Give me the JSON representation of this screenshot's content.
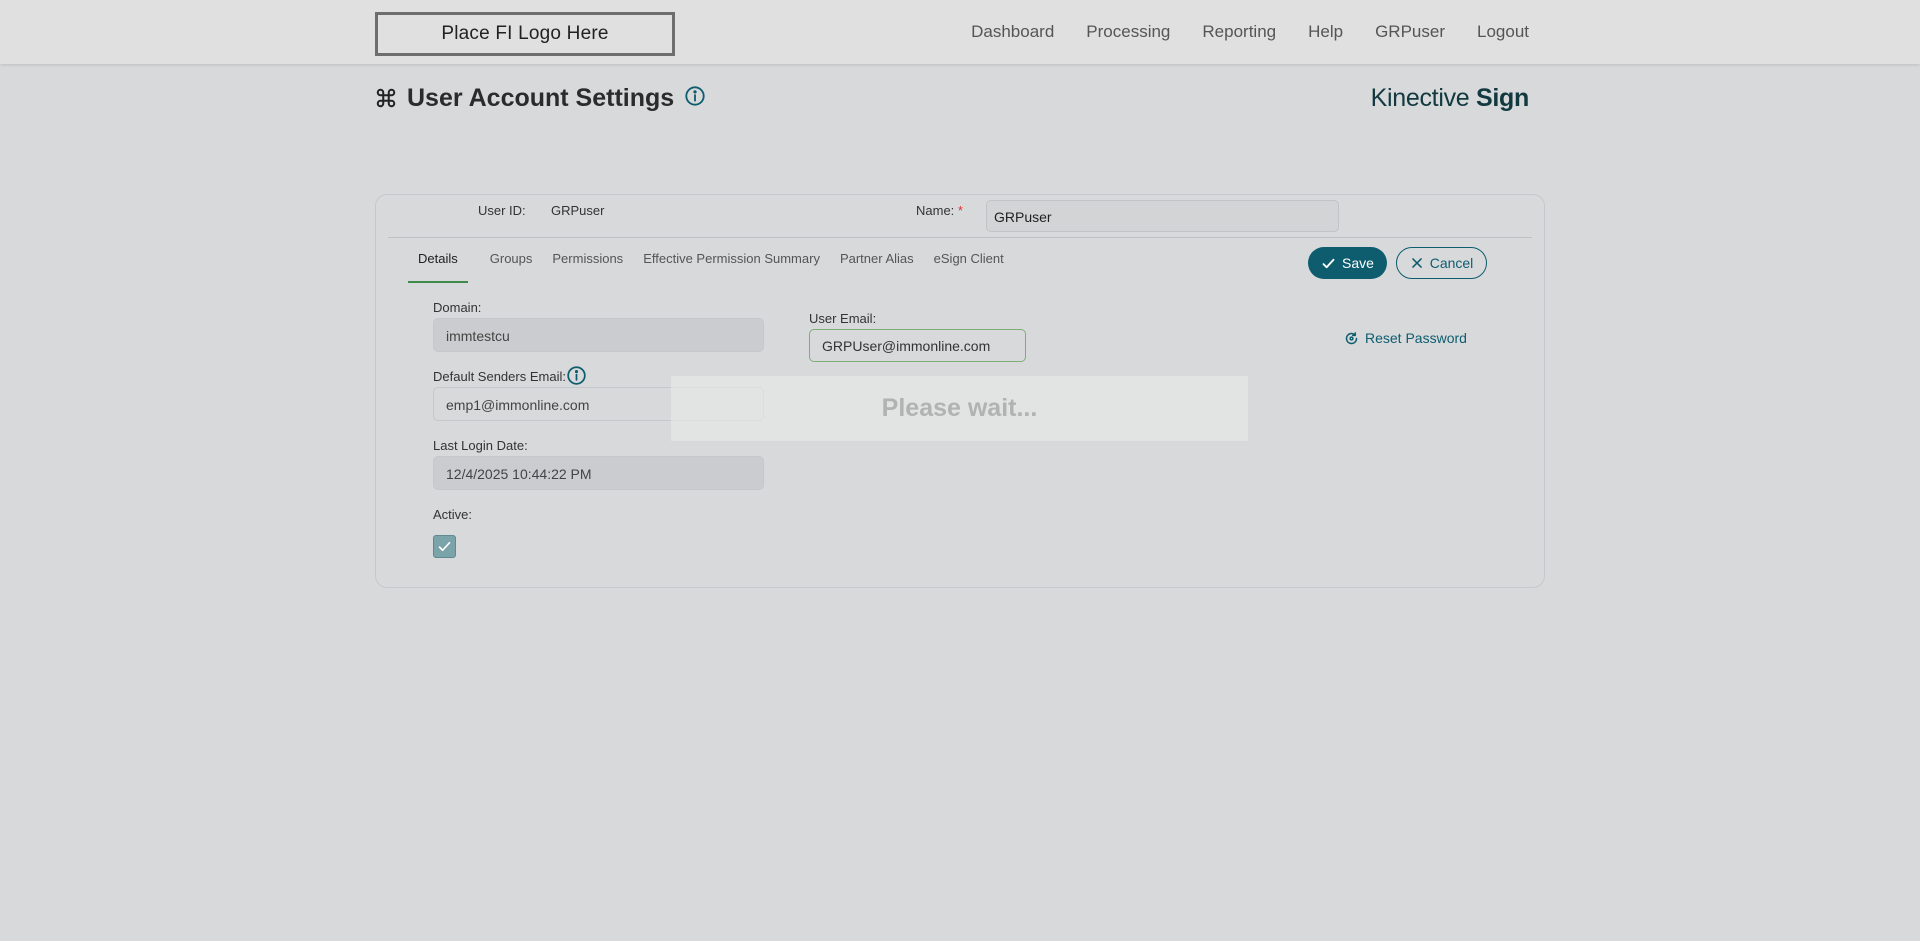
{
  "header": {
    "logo_text": "Place FI Logo Here",
    "nav": [
      "Dashboard",
      "Processing",
      "Reporting",
      "Help",
      "GRPuser",
      "Logout"
    ]
  },
  "page": {
    "title": "User Account Settings",
    "title_icon": "command-icon",
    "brand_light": "Kinective ",
    "brand_bold": "Sign"
  },
  "form": {
    "user_id_label": "User ID:",
    "user_id_value": "GRPuser",
    "name_label": "Name:",
    "required_mark": "*",
    "name_value": "GRPuser",
    "tabs": [
      "Details",
      "Groups",
      "Permissions",
      "Effective Permission Summary",
      "Partner Alias",
      "eSign Client"
    ],
    "active_tab": "Details",
    "save_label": "Save",
    "cancel_label": "Cancel",
    "domain_label": "Domain:",
    "domain_value": "immtestcu",
    "default_senders_email_label": "Default Senders Email:",
    "default_senders_email_value": "emp1@immonline.com",
    "last_login_label": "Last Login Date:",
    "last_login_value": "12/4/2025 10:44:22 PM",
    "active_label": "Active:",
    "active_checked": true,
    "user_email_label": "User Email:",
    "user_email_value": "GRPUser@immonline.com",
    "reset_password_label": "Reset Password"
  },
  "overlay": {
    "wait_text": "Please wait..."
  },
  "colors": {
    "accent": "#0d5d6e",
    "active_tab_underline": "#3f8a4a",
    "required": "#dd3333"
  }
}
